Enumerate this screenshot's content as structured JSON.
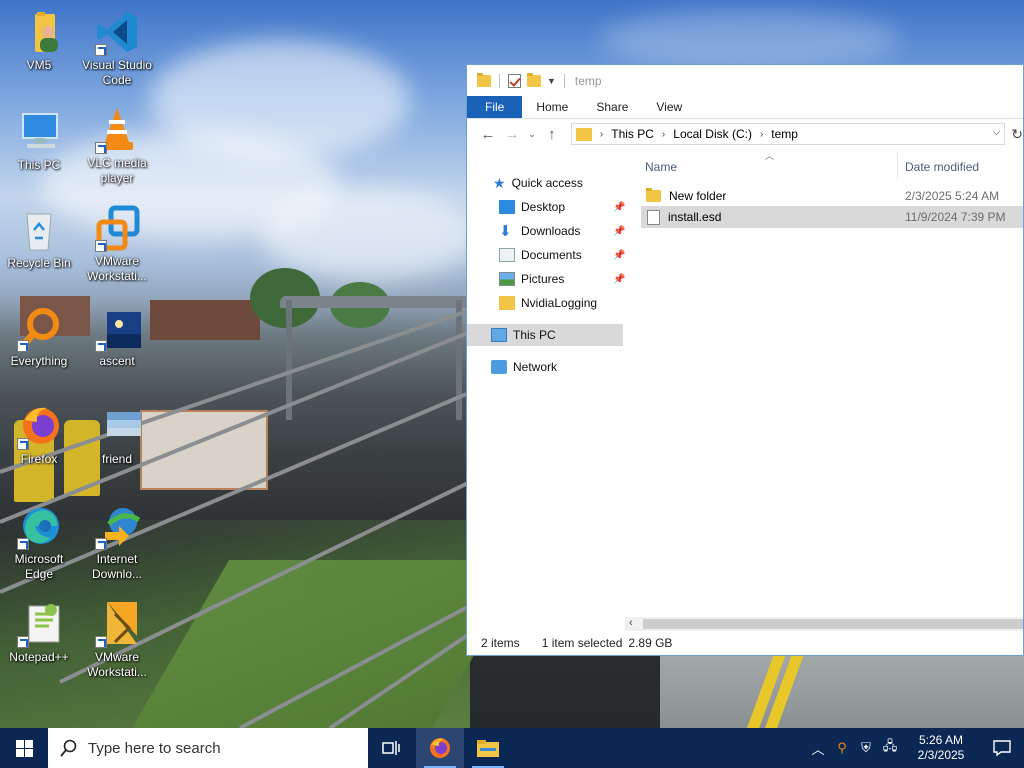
{
  "desktop": {
    "icons": [
      {
        "label": "VM5",
        "icon": "folder-user-icon"
      },
      {
        "label": "Visual Studio Code",
        "icon": "vscode-icon"
      },
      {
        "label": "This PC",
        "icon": "computer-icon"
      },
      {
        "label": "VLC media player",
        "icon": "vlc-icon"
      },
      {
        "label": "Recycle Bin",
        "icon": "recycle-bin-icon"
      },
      {
        "label": "VMware Workstati...",
        "icon": "vmware-icon"
      },
      {
        "label": "Everything",
        "icon": "everything-search-icon"
      },
      {
        "label": "ascent",
        "icon": "ascent-image-icon"
      },
      {
        "label": "Firefox",
        "icon": "firefox-icon"
      },
      {
        "label": "friend",
        "icon": "friend-image-icon"
      },
      {
        "label": "Microsoft Edge",
        "icon": "edge-icon"
      },
      {
        "label": "Internet Downlo...",
        "icon": "idm-icon"
      },
      {
        "label": "Notepad++",
        "icon": "notepadpp-icon"
      },
      {
        "label": "VMware Workstati...",
        "icon": "vmware-player-icon"
      }
    ]
  },
  "explorer": {
    "title": "temp",
    "ribbon_tabs": [
      "File",
      "Home",
      "Share",
      "View"
    ],
    "breadcrumb": [
      "This PC",
      "Local Disk (C:)",
      "temp"
    ],
    "nav": {
      "quick_access": "Quick access",
      "pinned": [
        "Desktop",
        "Downloads",
        "Documents",
        "Pictures"
      ],
      "nvidia": "NvidiaLogging",
      "this_pc": "This PC",
      "network": "Network"
    },
    "columns": {
      "name": "Name",
      "date": "Date modified"
    },
    "files": [
      {
        "name": "New folder",
        "date": "2/3/2025 5:24 AM",
        "type": "folder"
      },
      {
        "name": "install.esd",
        "date": "11/9/2024 7:39 PM",
        "type": "file"
      }
    ],
    "status": {
      "items": "2 items",
      "selected": "1 item selected",
      "size": "2.89 GB"
    }
  },
  "taskbar": {
    "search_placeholder": "Type here to search",
    "time": "5:26 AM",
    "date": "2/3/2025"
  }
}
